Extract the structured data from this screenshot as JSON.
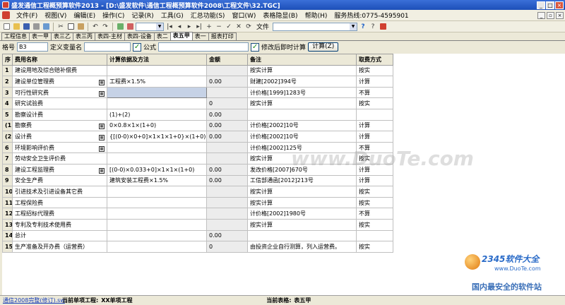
{
  "window": {
    "title": "盛发通信工程概预算软件2013 - [D:\\盛发软件\\通信工程概预算软件2008\\工程文件\\32.TGC]"
  },
  "menu": {
    "items": [
      "文件(F)",
      "视图(V)",
      "编辑(E)",
      "操作(C)",
      "记录(R)",
      "工具(G)",
      "汇总功能(S)",
      "窗口(W)",
      "表格隐显(B)",
      "帮助(H)"
    ],
    "hotline": "服务热线:0775-4595901"
  },
  "toolbar": {
    "file_label": "文件"
  },
  "tabs": [
    {
      "label": "工程信息"
    },
    {
      "label": "表一甲"
    },
    {
      "label": "表三乙"
    },
    {
      "label": "表三丙"
    },
    {
      "label": "表四-主材"
    },
    {
      "label": "表四-设备"
    },
    {
      "label": "表二"
    },
    {
      "label": "表五甲"
    },
    {
      "label": "表一"
    },
    {
      "label": "报表打印"
    }
  ],
  "formula_bar": {
    "cell_label": "格号",
    "cell_value": "B3",
    "define_var_label": "定义变量名",
    "formula_label": "公式",
    "recalc_label": "修改后即时计算",
    "calc_button": "计算(Z)"
  },
  "grid": {
    "headers": [
      "序",
      "费用名称",
      "计算依据及方法",
      "金额",
      "备注",
      "取费方式"
    ],
    "rows": [
      {
        "seq": "1",
        "name": "建设用地及综合赔补偿费",
        "basis": "",
        "amount": "",
        "note": "按实计算",
        "method": "按实",
        "icon": false,
        "sel": false
      },
      {
        "seq": "2",
        "name": "建设单位管理费",
        "basis": "工程费×1.5%",
        "amount": "0.00",
        "note": "财建[2002]394号",
        "method": "计算",
        "icon": true,
        "sel": false
      },
      {
        "seq": "3",
        "name": "可行性研究费",
        "basis": "",
        "amount": "",
        "note": "计价格[1999]1283号",
        "method": "不算",
        "icon": true,
        "sel": true
      },
      {
        "seq": "4",
        "name": "研究试验费",
        "basis": "",
        "amount": "0",
        "note": "按实计算",
        "method": "按实",
        "icon": false,
        "sel": false
      },
      {
        "seq": "5",
        "name": "勘察设计费",
        "basis": "(1)+(2)",
        "amount": "0.00",
        "note": "",
        "method": "",
        "icon": false,
        "sel": false
      },
      {
        "seq": "(1)",
        "name": "勘察费",
        "basis": "0×0.8×1×(1+0)",
        "amount": "0.00",
        "note": "计价格[2002]10号",
        "method": "计算",
        "icon": true,
        "sel": false
      },
      {
        "seq": "(2)",
        "name": "设计费",
        "basis": "{[(0-0)×0+0]×1×1×1+0}×(1+0)",
        "amount": "0.00",
        "note": "计价格[2002]10号",
        "method": "计算",
        "icon": true,
        "sel": false
      },
      {
        "seq": "6",
        "name": "环境影响评价费",
        "basis": "",
        "amount": "",
        "note": "计价格[2002]125号",
        "method": "不算",
        "icon": true,
        "sel": false
      },
      {
        "seq": "7",
        "name": "劳动安全卫生评价费",
        "basis": "",
        "amount": "",
        "note": "按实计算",
        "method": "按实",
        "icon": false,
        "sel": false
      },
      {
        "seq": "8",
        "name": "建设工程监理费",
        "basis": "[(0-0)×0.033+0]×1×1×(1+0)",
        "amount": "0.00",
        "note": "发改价格[2007]670号",
        "method": "计算",
        "icon": true,
        "sel": false
      },
      {
        "seq": "9",
        "name": "安全生产费",
        "basis": "建筑安装工程费×1.5%",
        "amount": "0.00",
        "note": "工信部通函[2012]213号",
        "method": "计算",
        "icon": false,
        "sel": false
      },
      {
        "seq": "10",
        "name": "引进技术及引进设备其它费",
        "basis": "",
        "amount": "",
        "note": "按实计算",
        "method": "按实",
        "icon": false,
        "sel": false
      },
      {
        "seq": "11",
        "name": "工程保险费",
        "basis": "",
        "amount": "",
        "note": "按实计算",
        "method": "按实",
        "icon": false,
        "sel": false
      },
      {
        "seq": "12",
        "name": "工程招标代理费",
        "basis": "",
        "amount": "",
        "note": "计价格[2002]1980号",
        "method": "不算",
        "icon": false,
        "sel": false
      },
      {
        "seq": "13",
        "name": "专利及专利技术使用费",
        "basis": "",
        "amount": "",
        "note": "按实计算",
        "method": "按实",
        "icon": false,
        "sel": false
      },
      {
        "seq": "14",
        "name": "总计",
        "basis": "",
        "amount": "0.00",
        "note": "",
        "method": "",
        "icon": false,
        "sel": false
      },
      {
        "seq": "15",
        "name": "生产准备及开办费（运营费）",
        "basis": "",
        "amount": "0",
        "note": "由投资企业自行测算，列入运营费。",
        "method": "按实",
        "icon": false,
        "sel": false
      }
    ]
  },
  "status": {
    "version": "通信2008完整(修订).sw",
    "project_label": "当前单项工程:",
    "project_value": "XX单项工程",
    "table_label": "当前表格:",
    "table_value": "表五甲"
  },
  "watermarks": {
    "center": "www.DuoTe.com",
    "brand": "2345软件大全",
    "url": "www.DuoTe.com",
    "slogan": "国内最安全的软件站"
  }
}
